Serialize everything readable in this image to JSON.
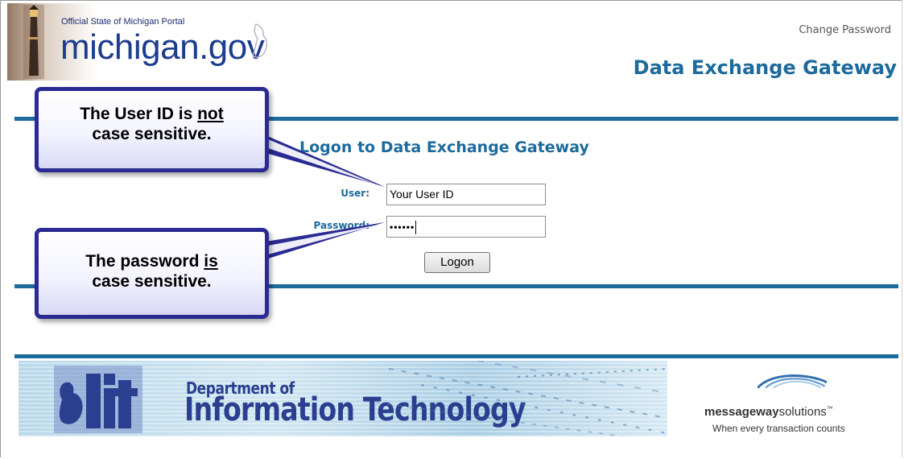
{
  "header": {
    "portal_text": "Official State of Michigan Portal",
    "logo_text": "michigan.gov",
    "change_password": "Change Password",
    "app_title": "Data Exchange Gateway"
  },
  "form": {
    "title": "Logon to Data Exchange Gateway",
    "user_label": "User:",
    "user_value": "Your User ID",
    "password_label": "Password:",
    "password_value": "••••••",
    "logon_button": "Logon"
  },
  "callouts": {
    "user_line1_pre": "The User ID is ",
    "user_line1_em": "not",
    "user_line2": "case sensitive.",
    "pw_line1_pre": "The password ",
    "pw_line1_em": "is",
    "pw_line2": "case sensitive."
  },
  "footer": {
    "dit_logo_text": "dit",
    "dept_of": "Department of",
    "info_tech": "Information Technology",
    "mw_bold": "messageway",
    "mw_rest": "solutions",
    "mw_tm": "™",
    "mw_tagline": "When every transaction counts"
  },
  "colors": {
    "brand_blue": "#1d6a9c",
    "callout_border": "#2a2a92",
    "dit_text": "#2a3f8f"
  }
}
